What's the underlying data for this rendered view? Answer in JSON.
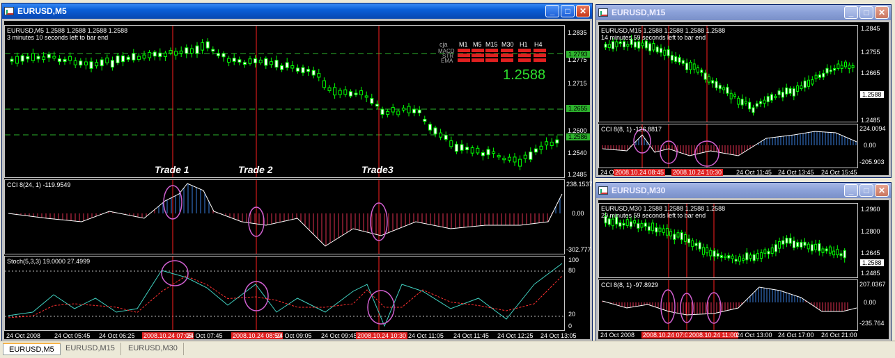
{
  "windows": {
    "m5": {
      "title": "EURUSD,M5",
      "header": "EURUSD,M5  1.2588 1.2588 1.2588 1.2588",
      "countdown": "3 minutes 10 seconds left to bar end",
      "price_scale": [
        "1.2835",
        "1.2775",
        "1.2715",
        "1.2600",
        "1.2540",
        "1.2485"
      ],
      "price_tags": [
        "1.2793",
        "1.2655",
        "1.2586"
      ],
      "dashboard": {
        "prefix": "cja",
        "timeframes": [
          "M1",
          "M5",
          "M15",
          "M30",
          "H1",
          "H4"
        ],
        "rows": [
          "MACD",
          "STR",
          "EMA"
        ],
        "price": "1.2588"
      },
      "trades": [
        "Trade 1",
        "Trade 2",
        "Trade3"
      ],
      "cci_label": "CCI 8(24, 1) -119.9549",
      "cci_scale": [
        "238.1537",
        "0.00",
        "-302.777"
      ],
      "stoch_label": "Stoch(5,3,3) 19.0000 27.4999",
      "stoch_scale": [
        "100",
        "80",
        "20",
        "0"
      ],
      "time_axis": [
        "24 Oct 2008",
        "24 Oct 05:45",
        "24 Oct 06:25",
        "2008.10.24 07:05",
        "24 Oct 07:45",
        "2008.10.24 08:50",
        "24 Oct 09:05",
        "24 Oct 09:45",
        "2008.10.24 10:30",
        "24 Oct 11:05",
        "24 Oct 11:45",
        "24 Oct 12:25",
        "24 Oct 13:05"
      ]
    },
    "m15": {
      "title": "EURUSD,M15",
      "header": "EURUSD,M15  1.2588 1.2588 1.2588 1.2588",
      "countdown": "14 minutes 59 seconds left to bar end",
      "price_scale": [
        "1.2845",
        "1.2755",
        "1.2665",
        "1.2485"
      ],
      "price_tag": "1.2588",
      "cci_label": "CCI 8(8, 1) -126.8817",
      "cci_scale": [
        "224.0094",
        "0.00",
        "-205.903"
      ],
      "time_axis": [
        "24 Oct",
        "2008.10.24 08:45",
        "2008.10.24 10:30",
        "24 Oct 11:45",
        "24 Oct 13:45",
        "24 Oct 15:45"
      ]
    },
    "m30": {
      "title": "EURUSD,M30",
      "header": "EURUSD,M30  1.2588 1.2588 1.2588 1.2588",
      "countdown": "29 minutes 59 seconds left to bar end",
      "price_scale": [
        "1.2960",
        "1.2800",
        "1.2645",
        "1.2485"
      ],
      "price_tag": "1.2588",
      "cci_label": "CCI 8(8, 1) -97.8929",
      "cci_scale": [
        "207.0367",
        "0.00",
        "-235.764"
      ],
      "time_axis": [
        "24 Oct 2008",
        "2008.10.24 07:00",
        "2008.10.24 11:00",
        "24 Oct 13:00",
        "24 Oct 17:00",
        "24 Oct 21:00"
      ]
    }
  },
  "tabs": [
    "EURUSD,M5",
    "EURUSD,M15",
    "EURUSD,M30"
  ],
  "colors": {
    "bull": "#00ff00",
    "bear": "#ffffff",
    "level": "#2db32d",
    "vline": "#ff2020",
    "cci_neg": "#e03050",
    "cci_pos": "#3a7fe0",
    "stoch_main": "#40d0c0",
    "stoch_signal": "#ff3030",
    "circle": "#d060d0"
  }
}
